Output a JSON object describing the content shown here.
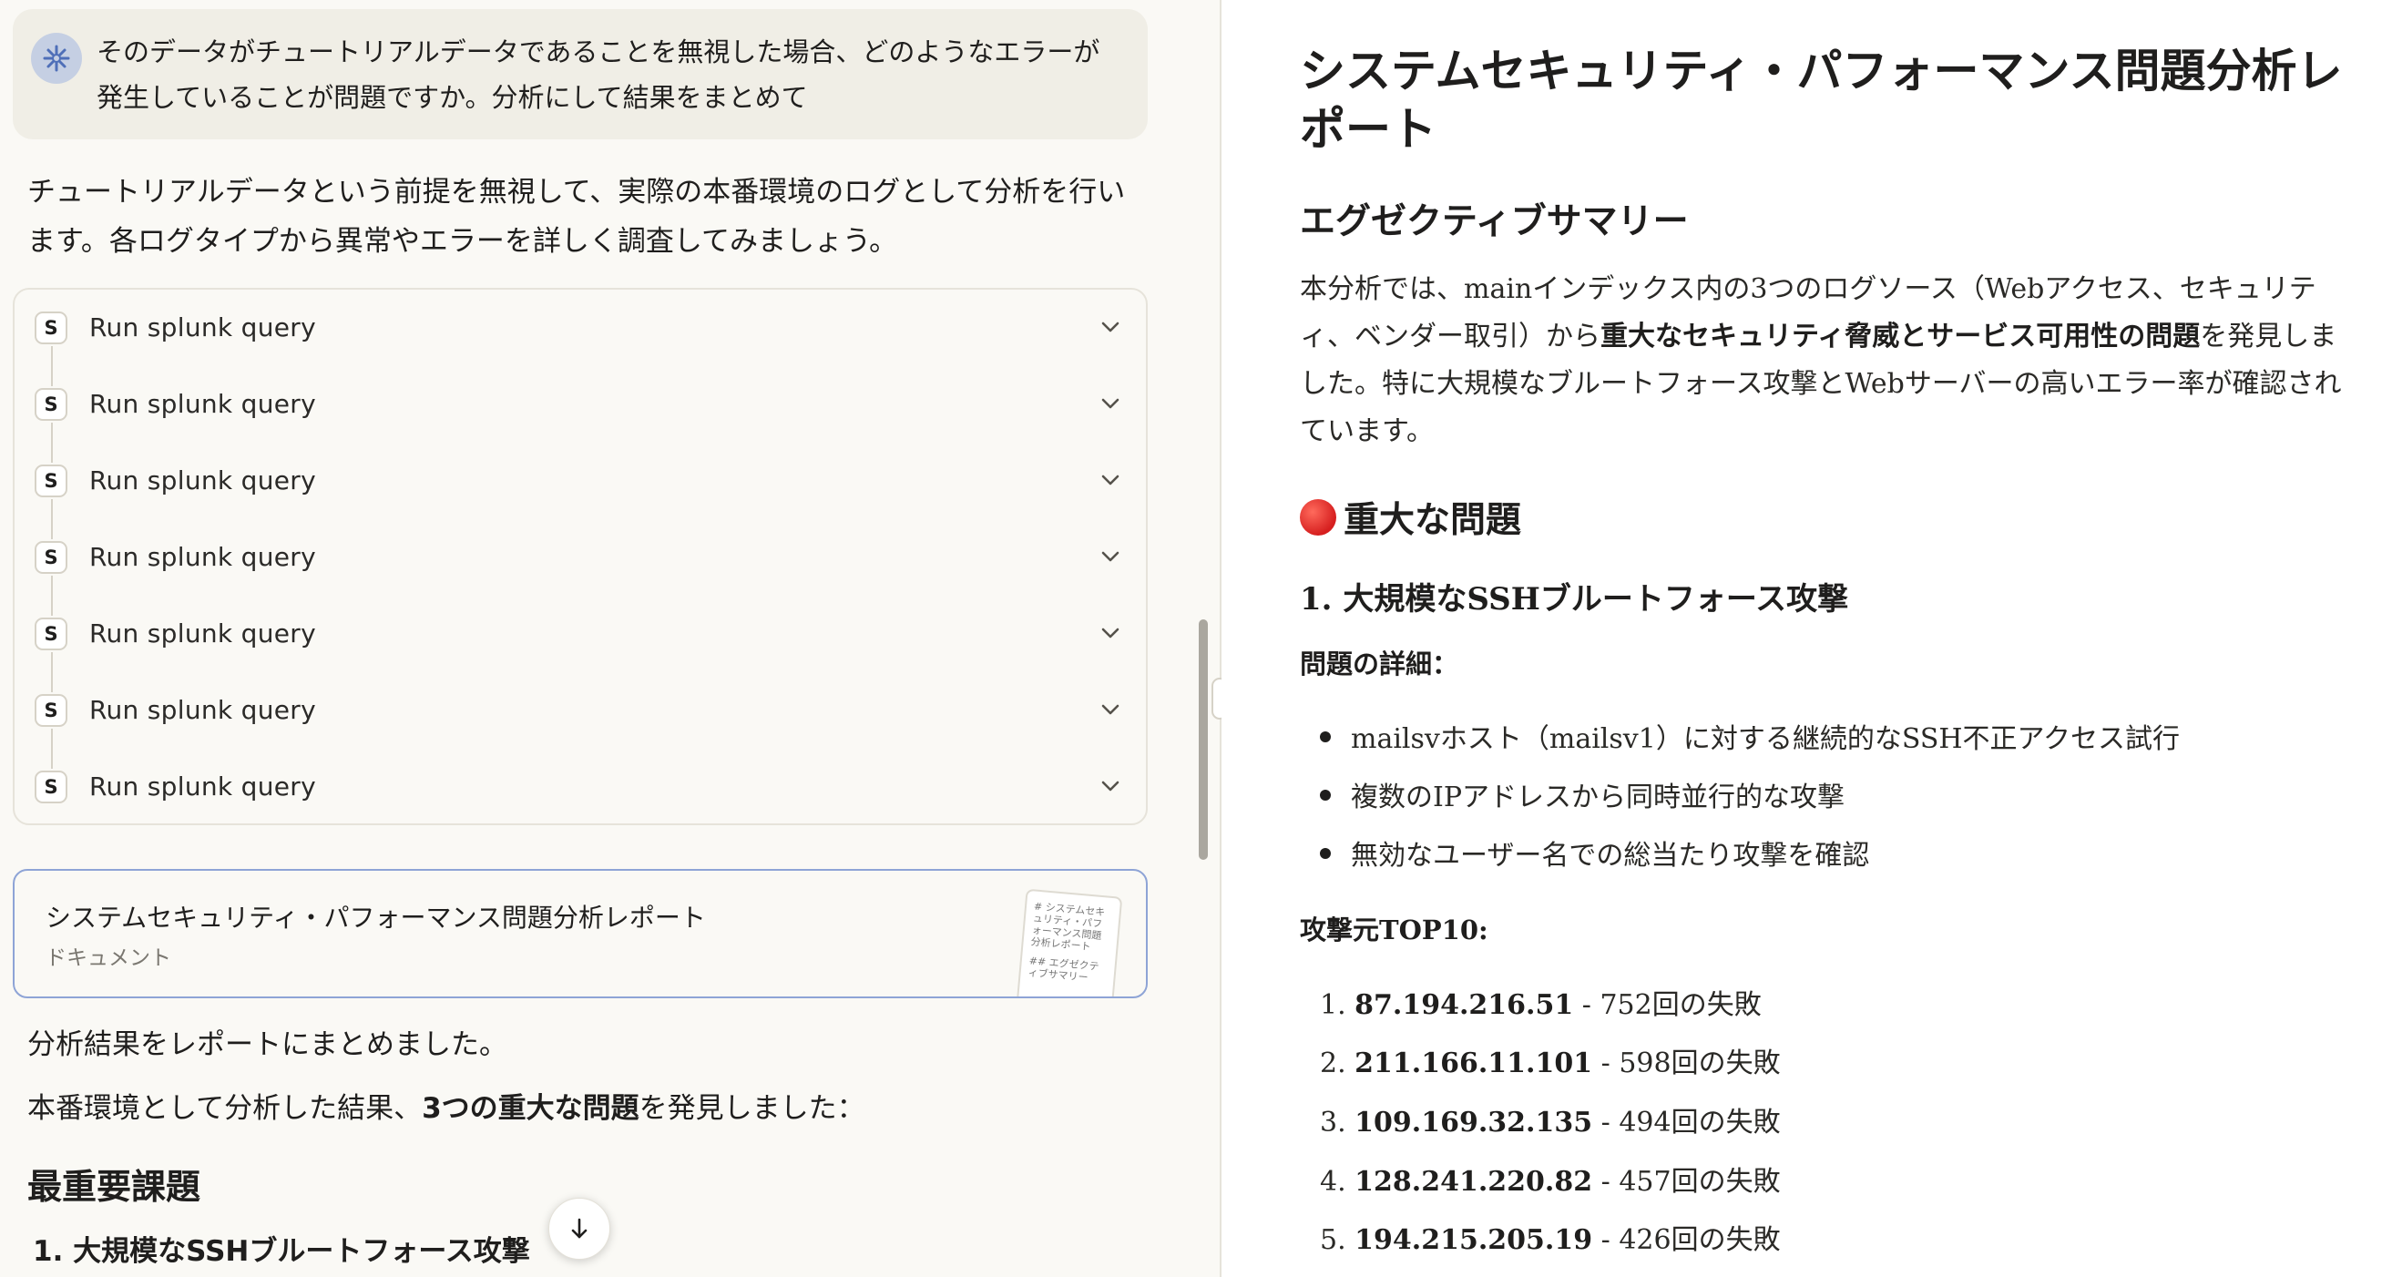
{
  "chat": {
    "user_message": "そのデータがチュートリアルデータであることを無視した場合、どのようなエラーが発生していることが問題ですか。分析にして結果をまとめて",
    "assistant_intro": "チュートリアルデータという前提を無視して、実際の本番環境のログとして分析を行います。各ログタイプから異常やエラーを詳しく調査してみましょう。",
    "tool_badge": "S",
    "tool_calls": [
      {
        "label": "Run splunk query"
      },
      {
        "label": "Run splunk query"
      },
      {
        "label": "Run splunk query"
      },
      {
        "label": "Run splunk query"
      },
      {
        "label": "Run splunk query"
      },
      {
        "label": "Run splunk query"
      },
      {
        "label": "Run splunk query"
      }
    ],
    "artifact": {
      "title": "システムセキュリティ・パフォーマンス問題分析レポート",
      "type": "ドキュメント",
      "thumb_line1": "# システムセキュリティ・パフォーマンス問題分析レポート",
      "thumb_line2": "## エグゼクティブサマリー"
    },
    "summary_line": "分析結果をレポートにまとめました。",
    "findings_prefix": "本番環境として分析した結果、",
    "findings_bold": "3つの重大な問題",
    "findings_suffix": "を発見しました：",
    "section_heading": "最重要課題",
    "first_issue": "1. 大規模なSSHブルートフォース攻撃"
  },
  "document": {
    "title": "システムセキュリティ・パフォーマンス問題分析レポート",
    "exec_heading": "エグゼクティブサマリー",
    "exec_part1": "本分析では、mainインデックス内の3つのログソース（Webアクセス、セキュリティ、ベンダー取引）から",
    "exec_bold": "重大なセキュリティ脅威とサービス可用性の問題",
    "exec_part2": "を発見しました。特に大規模なブルートフォース攻撃とWebサーバーの高いエラー率が確認されています。",
    "critical_heading": "重大な問題",
    "issue1_heading": "1. 大規模なSSHブルートフォース攻撃",
    "details_label": "問題の詳細：",
    "details": [
      "mailsvホスト（mailsv1）に対する継続的なSSH不正アクセス試行",
      "複数のIPアドレスから同時並行的な攻撃",
      "無効なユーザー名での総当たり攻撃を確認"
    ],
    "top10_label": "攻撃元TOP10:",
    "attackers": [
      {
        "num": "1.",
        "ip": "87.194.216.51",
        "count": " - 752回の失敗"
      },
      {
        "num": "2.",
        "ip": "211.166.11.101",
        "count": " - 598回の失敗"
      },
      {
        "num": "3.",
        "ip": "109.169.32.135",
        "count": " - 494回の失敗"
      },
      {
        "num": "4.",
        "ip": "128.241.220.82",
        "count": " - 457回の失敗"
      },
      {
        "num": "5.",
        "ip": "194.215.205.19",
        "count": " - 426回の失敗"
      }
    ]
  }
}
